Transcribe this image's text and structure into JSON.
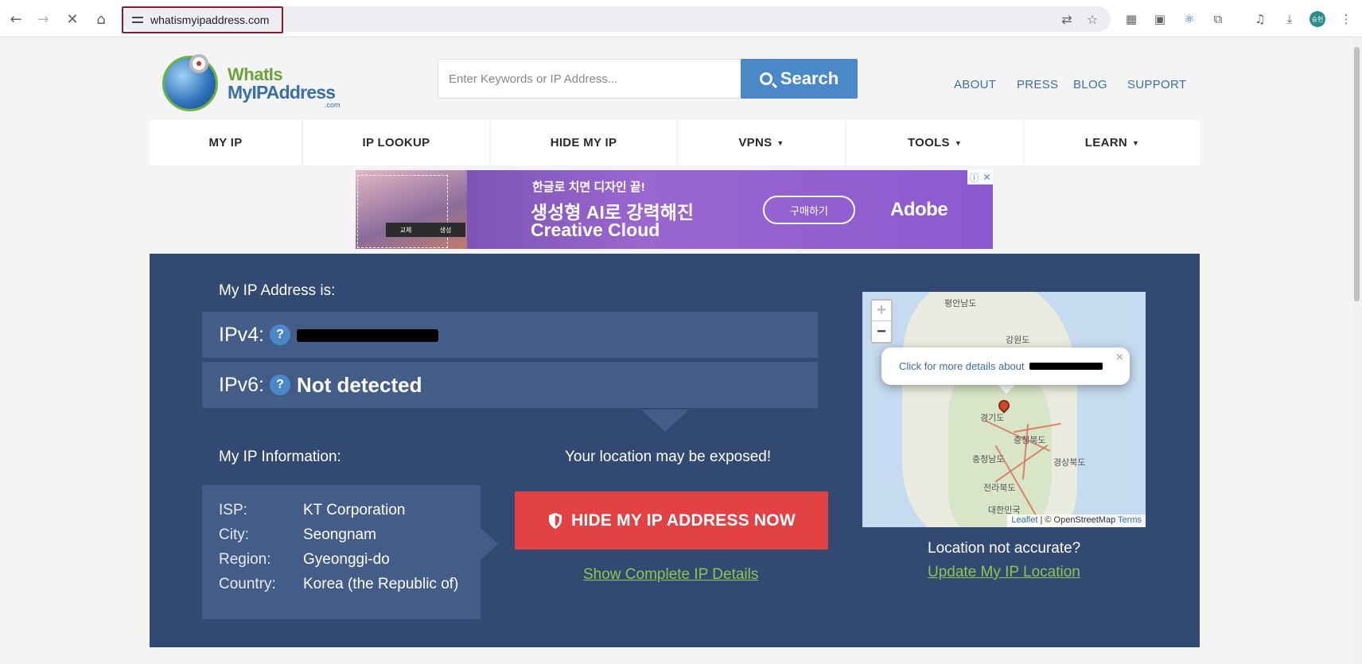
{
  "browser": {
    "url": "whatismyipaddress.com",
    "profile_initials": "승헌"
  },
  "logo": {
    "line1": "WhatIs",
    "line2": "MyIPAddress",
    "line3": ".com"
  },
  "search": {
    "placeholder": "Enter Keywords or IP Address...",
    "button_label": "Search"
  },
  "top_links": [
    "ABOUT",
    "PRESS",
    "BLOG",
    "SUPPORT"
  ],
  "nav": [
    {
      "label": "MY IP",
      "caret": ""
    },
    {
      "label": "IP LOOKUP",
      "caret": ""
    },
    {
      "label": "HIDE MY IP",
      "caret": ""
    },
    {
      "label": "VPNS",
      "caret": "▼"
    },
    {
      "label": "TOOLS",
      "caret": "▼"
    },
    {
      "label": "LEARN",
      "caret": "▼"
    }
  ],
  "ad": {
    "line1": "한글로 치면 디자인 끝!",
    "line2": "생성형 AI로 강력해진",
    "line3": "Creative Cloud",
    "cta": "구매하기",
    "brand": "Adobe",
    "img_btn1": "교체",
    "img_btn2": "생성"
  },
  "ip": {
    "heading": "My IP Address is:",
    "ipv4_label": "IPv4:",
    "ipv6_label": "IPv6:",
    "ipv6_value": "Not detected",
    "help_glyph": "?"
  },
  "info": {
    "heading": "My IP Information:",
    "rows": [
      {
        "key": "ISP:",
        "value": "KT Corporation"
      },
      {
        "key": "City:",
        "value": "Seongnam"
      },
      {
        "key": "Region:",
        "value": "Gyeonggi-do"
      },
      {
        "key": "Country:",
        "value": "Korea (the Republic of)"
      }
    ]
  },
  "exposure": {
    "warning": "Your location may be exposed!",
    "hide_button": "HIDE MY IP ADDRESS NOW",
    "details_link": "Show Complete IP Details"
  },
  "map": {
    "zoom_in": "+",
    "zoom_out": "−",
    "popup_text": "Click for more details about",
    "popup_close": "×",
    "places": [
      "평안남도",
      "강원도",
      "경기도",
      "충청북도",
      "충청남도",
      "경상북도",
      "전라북도",
      "대한민국"
    ],
    "attribution_leaflet": "Leaflet",
    "attribution_osm": "| © OpenStreetMap",
    "attribution_terms": "Terms"
  },
  "location": {
    "question": "Location not accurate?",
    "update_link": "Update My IP Location"
  }
}
